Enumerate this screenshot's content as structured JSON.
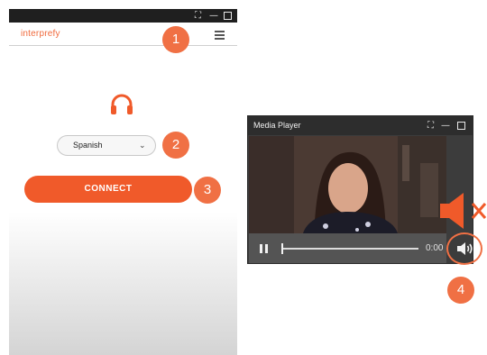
{
  "app": {
    "logo_text": "interprefy",
    "language_value": "Spanish",
    "connect_label": "CONNECT"
  },
  "media_player": {
    "title": "Media Player",
    "time": "0:00",
    "progress_fraction": 0
  },
  "callouts": [
    "1",
    "2",
    "3",
    "4"
  ],
  "colors": {
    "accent": "#f05a2a",
    "callout": "#f07044",
    "titlebar": "#1f1f1f"
  },
  "icons": [
    "fullscreen-icon",
    "minimize-icon",
    "maximize-icon",
    "hamburger-menu-icon",
    "headphones-icon",
    "chevron-down-icon",
    "pause-icon",
    "volume-icon",
    "mute-icon"
  ]
}
